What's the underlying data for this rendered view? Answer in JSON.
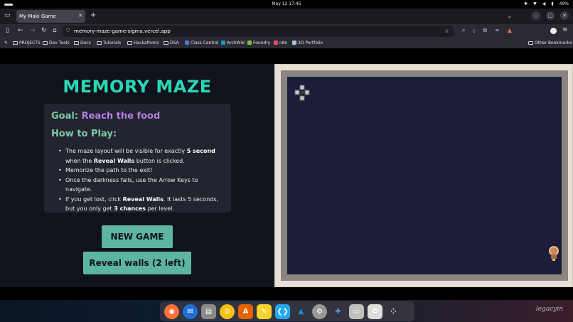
{
  "system": {
    "clock": "May 12  17:45",
    "battery": "49%"
  },
  "browser": {
    "tab_title": "My Maki Game",
    "url": "memory-maze-game-sigma.vercel.app",
    "bookmarks": [
      "PROJECTS",
      "Dev Tools",
      "Docs",
      "Tutorials",
      "Hackathons",
      "DSA",
      "Class Central",
      "ArchWiki",
      "Foundry",
      "n8n",
      "3D Portfolio"
    ],
    "other_bookmarks": "Other Bookmarks"
  },
  "game": {
    "title": "MEMORY MAZE",
    "goal_label": "Goal:",
    "goal_value": "Reach the food",
    "howto_label": "How to Play:",
    "rules": {
      "r1_a": "The maze layout will be visible for exactly ",
      "r1_b": "5 second",
      "r1_c": " when the ",
      "r1_d": "Reveal Walls",
      "r1_e": " button is clicked.",
      "r2": "Memorize the path to the exit!",
      "r3": "Once the darkness falls, use the Arrow Keys to navigate.",
      "r4_a": "If you get lost, click ",
      "r4_b": "Reveal Walls",
      "r4_c": ". It lasts 5 seconds, but you only get ",
      "r4_d": "3 chances",
      "r4_e": " per level."
    },
    "new_game_label": "NEW GAME",
    "reveal_label": "Reveal walls (2 left)"
  },
  "dock": {
    "watermark": "legacyin",
    "apps": [
      "firefox-icon",
      "thunderbird-icon",
      "files-icon",
      "rhythmbox-icon",
      "software-icon",
      "text-editor-icon",
      "vscode-icon",
      "arch-icon",
      "settings-icon",
      "extensions-icon",
      "ssd-icon",
      "trash-icon",
      "app-grid-icon"
    ]
  },
  "colors": {
    "accent_teal": "#2ad7b6",
    "button_bg": "#5db5a0",
    "goal_purple": "#b57be0",
    "maze_bg": "#1d1d3a"
  }
}
